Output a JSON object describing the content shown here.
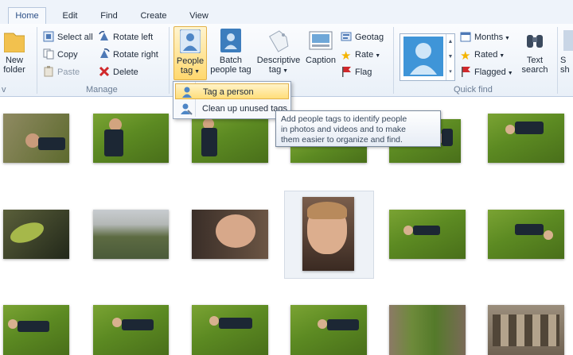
{
  "tabs": [
    {
      "label": "Home",
      "active": true
    },
    {
      "label": "Edit"
    },
    {
      "label": "Find"
    },
    {
      "label": "Create"
    },
    {
      "label": "View"
    }
  ],
  "ribbon": {
    "new_folder_label_1": "New",
    "new_folder_label_2": "folder",
    "manage": {
      "select_all": "Select all",
      "copy": "Copy",
      "paste": "Paste",
      "rotate_left": "Rotate left",
      "rotate_right": "Rotate right",
      "delete": "Delete",
      "group_label": "Manage"
    },
    "tag": {
      "people_tag_1": "People",
      "people_tag_2": "tag",
      "batch_1": "Batch",
      "batch_2": "people tag",
      "descriptive_1": "Descriptive",
      "descriptive_2": "tag",
      "caption": "Caption",
      "geotag": "Geotag",
      "rate": "Rate",
      "flag": "Flag"
    },
    "quick_find": {
      "months": "Months",
      "rated": "Rated",
      "flagged": "Flagged",
      "text_search_1": "Text",
      "text_search_2": "search",
      "group_label": "Quick find"
    },
    "cut_off_1": "S",
    "cut_off_2": "sh",
    "left_group_fragment": "v"
  },
  "people_tag_menu": {
    "items": [
      {
        "label": "Tag a person",
        "highlighted": true
      },
      {
        "label": "Clean up unused tags"
      }
    ]
  },
  "tooltip": {
    "line1": "Add people tags to identify people",
    "line2": "in photos and videos and to make",
    "line3": "them easier to organize and find."
  },
  "colors": {
    "accent": "#2a4e86",
    "highlight": "#ffd86e",
    "flag_red": "#d0282b"
  }
}
